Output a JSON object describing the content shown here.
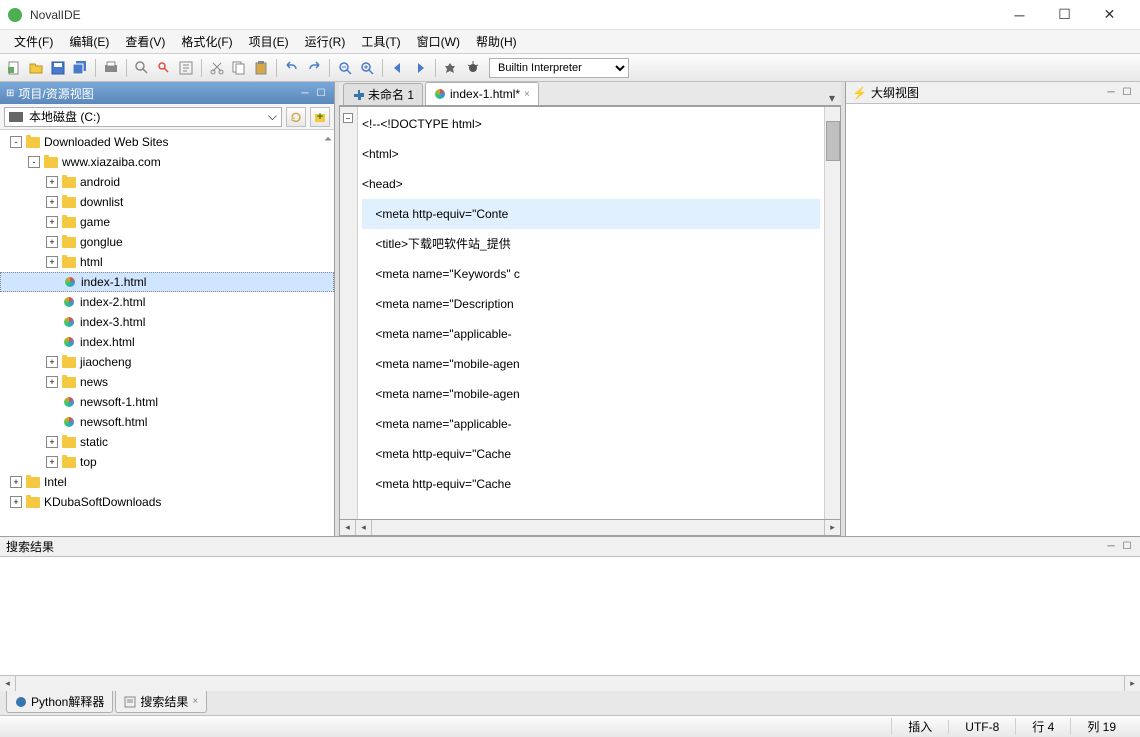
{
  "window": {
    "title": "NovalIDE"
  },
  "menu": {
    "file": "文件(F)",
    "edit": "编辑(E)",
    "view": "查看(V)",
    "format": "格式化(F)",
    "project": "项目(E)",
    "run": "运行(R)",
    "tools": "工具(T)",
    "window": "窗口(W)",
    "help": "帮助(H)"
  },
  "toolbar": {
    "interpreter": "Builtin Interpreter"
  },
  "leftPanel": {
    "title": "项目/资源视图",
    "drive": "本地磁盘 (C:)"
  },
  "tree": [
    {
      "depth": 0,
      "type": "folder",
      "toggle": "-",
      "label": "Downloaded Web Sites"
    },
    {
      "depth": 1,
      "type": "folder",
      "toggle": "-",
      "label": "www.xiazaiba.com"
    },
    {
      "depth": 2,
      "type": "folder",
      "toggle": "+",
      "label": "android"
    },
    {
      "depth": 2,
      "type": "folder",
      "toggle": "+",
      "label": "downlist"
    },
    {
      "depth": 2,
      "type": "folder",
      "toggle": "+",
      "label": "game"
    },
    {
      "depth": 2,
      "type": "folder",
      "toggle": "+",
      "label": "gonglue"
    },
    {
      "depth": 2,
      "type": "folder",
      "toggle": "+",
      "label": "html"
    },
    {
      "depth": 2,
      "type": "html",
      "toggle": "",
      "label": "index-1.html",
      "selected": true
    },
    {
      "depth": 2,
      "type": "html",
      "toggle": "",
      "label": "index-2.html"
    },
    {
      "depth": 2,
      "type": "html",
      "toggle": "",
      "label": "index-3.html"
    },
    {
      "depth": 2,
      "type": "html",
      "toggle": "",
      "label": "index.html"
    },
    {
      "depth": 2,
      "type": "folder",
      "toggle": "+",
      "label": "jiaocheng"
    },
    {
      "depth": 2,
      "type": "folder",
      "toggle": "+",
      "label": "news"
    },
    {
      "depth": 2,
      "type": "html",
      "toggle": "",
      "label": "newsoft-1.html"
    },
    {
      "depth": 2,
      "type": "html",
      "toggle": "",
      "label": "newsoft.html"
    },
    {
      "depth": 2,
      "type": "folder",
      "toggle": "+",
      "label": "static"
    },
    {
      "depth": 2,
      "type": "folder",
      "toggle": "+",
      "label": "top"
    },
    {
      "depth": 0,
      "type": "folder",
      "toggle": "+",
      "label": "Intel"
    },
    {
      "depth": 0,
      "type": "folder",
      "toggle": "+",
      "label": "KDubaSoftDownloads"
    }
  ],
  "tabs": {
    "tab1": "未命名 1",
    "tab2": "index-1.html*"
  },
  "code": [
    {
      "text": "<!--<!DOCTYPE html>",
      "hl": false
    },
    {
      "text": "<html>",
      "hl": false
    },
    {
      "text": "<head>",
      "hl": false
    },
    {
      "text": "    <meta http-equiv=\"Conte",
      "hl": true
    },
    {
      "text": "    <title>下载吧软件站_提供",
      "hl": false
    },
    {
      "text": "    <meta name=\"Keywords\" c",
      "hl": false
    },
    {
      "text": "    <meta name=\"Description",
      "hl": false
    },
    {
      "text": "    <meta name=\"applicable-",
      "hl": false
    },
    {
      "text": "    <meta name=\"mobile-agen",
      "hl": false
    },
    {
      "text": "    <meta name=\"mobile-agen",
      "hl": false
    },
    {
      "text": "    <meta name=\"applicable-",
      "hl": false
    },
    {
      "text": "    <meta http-equiv=\"Cache",
      "hl": false
    },
    {
      "text": "    <meta http-equiv=\"Cache",
      "hl": false
    }
  ],
  "rightPanel": {
    "title": "大纲视图"
  },
  "bottomPanel": {
    "title": "搜索结果",
    "tab1": "Python解释器",
    "tab2": "搜索结果"
  },
  "status": {
    "mode": "插入",
    "encoding": "UTF-8",
    "line": "行 4",
    "col": "列 19"
  }
}
